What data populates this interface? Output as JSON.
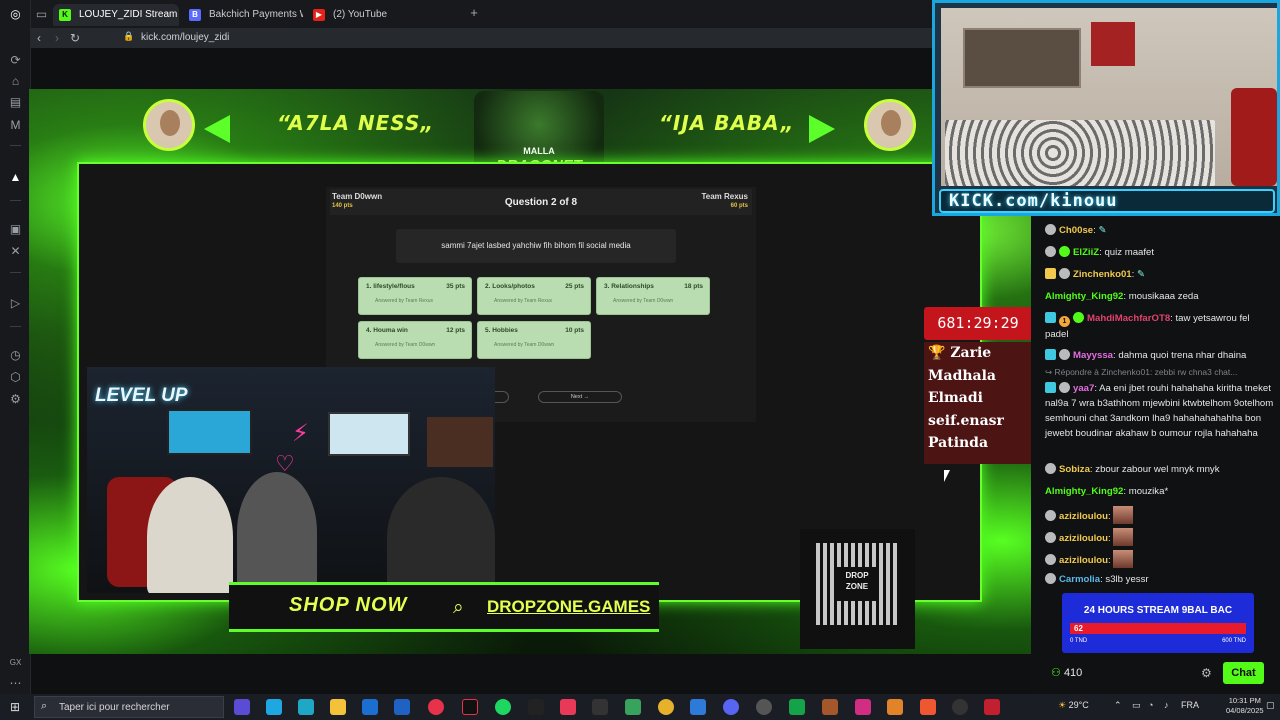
{
  "browser": {
    "tabs": [
      {
        "label": "LOUJEY_ZIDI Stream",
        "favicon": "K",
        "active": true
      },
      {
        "label": "Bakchich Payments Work",
        "favicon": "B",
        "active": false
      },
      {
        "label": "(2) YouTube",
        "favicon": "youtube-icon",
        "active": false
      }
    ],
    "url": "kick.com/loujey_zidi"
  },
  "overlay": {
    "left_banner": "“A7LA NESS„",
    "right_banner": "“IJA BABA„",
    "logo_small": "MALLA",
    "logo_main": "DRAGONET",
    "shop_text": "SHOP NOW",
    "shop_url": "DROPZONE.GAMES",
    "qr_text": "DROP ZONE",
    "pip_banner": "KICK.com/kinouu"
  },
  "quiz": {
    "team_left": "Team D0wwn",
    "team_left_pts": "140 pts",
    "team_right": "Team Rexus",
    "team_right_pts": "60 pts",
    "question_title": "Question 2 of 8",
    "question_text": "sammi 7ajet lasbed yahchiw fih bihom fil social media",
    "cards": [
      {
        "label": "1. lifestyle/flous",
        "points": "35 pts",
        "sub": "Answered by Team Rexus"
      },
      {
        "label": "2. Looks/photos",
        "points": "25 pts",
        "sub": "Answered by Team Rexus"
      },
      {
        "label": "3. Relationships",
        "points": "18 pts",
        "sub": "Answered by Team D0wwn"
      },
      {
        "label": "4. Houma win",
        "points": "12 pts",
        "sub": "Answered by Team D0wwn"
      },
      {
        "label": "5. Hobbies",
        "points": "10 pts",
        "sub": "Answered by Team D0wwn"
      }
    ],
    "next_label": "Next →"
  },
  "timer": "681:29:29",
  "leaderboard": [
    "Zarie",
    "Madhala",
    "Elmadi",
    "seif.enasr",
    "Patinda"
  ],
  "cam": {
    "neon_sign": "LEVEL UP"
  },
  "chat": {
    "messages": [
      {
        "user": "Ch00se",
        "text": "",
        "color": "#f2c94c",
        "emote": true
      },
      {
        "user": "ElZiiZ",
        "text": "quiz maafet",
        "color": "#53fc18"
      },
      {
        "user": "Zinchenko01",
        "text": "",
        "color": "#f2c94c",
        "emote": true
      },
      {
        "user": "Almighty_King92",
        "text": "mousikaaa zeda",
        "color": "#53fc18"
      },
      {
        "user": "MahdiMachfarOT8",
        "text": "taw yetsawrou fel padel",
        "color": "#e0436e"
      },
      {
        "user": "Mayyssa",
        "text": "dahma quoi trena nhar dhaina",
        "color": "#e36ee0"
      },
      {
        "user": "yaa7",
        "text": "Aa eni jbet rouhi hahahaha kiritha tneket nal9a 7 wra b3athhom mjewbini ktwbtelhom 9otelhom semhouni chat 3andkom lha9 hahahahahahha bon jewebt boudinar akahaw b oumour rojla hahahaha",
        "color": "#e36ee0"
      },
      {
        "user": "Sobiza",
        "text": "zbour zabour wel mnyk mnyk",
        "color": "#f2c94c"
      },
      {
        "user": "Almighty_King92",
        "text": "mouzika*",
        "color": "#53fc18"
      },
      {
        "user": "aziziloulou",
        "text": "",
        "color": "#f2c94c",
        "emote": true
      },
      {
        "user": "aziziloulou",
        "text": "",
        "color": "#f2c94c",
        "emote": true
      },
      {
        "user": "aziziloulou",
        "text": "",
        "color": "#f2c94c",
        "emote": true
      },
      {
        "user": "Carmolia",
        "text": "s3lb yessr",
        "color": "#5db9e8"
      }
    ],
    "reply_line": "↪ Répondre à Zinchenko01: zebbi rw chna3 chat...",
    "goal_title": "24 HOURS STREAM 9BAL BAC",
    "goal_value": "62",
    "goal_min": "0 TND",
    "goal_max": "600 TND",
    "goal_fraction": 0.103,
    "viewers": "410",
    "chat_button": "Chat"
  },
  "taskbar": {
    "search_placeholder": "Taper ici pour rechercher",
    "weather": "29°C",
    "lang": "FRA",
    "time": "10:31 PM",
    "date": "04/08/2025"
  },
  "colors": {
    "kick_green": "#53fc18",
    "overlay_green": "#5dff2a",
    "timer_red": "#c4151d"
  }
}
